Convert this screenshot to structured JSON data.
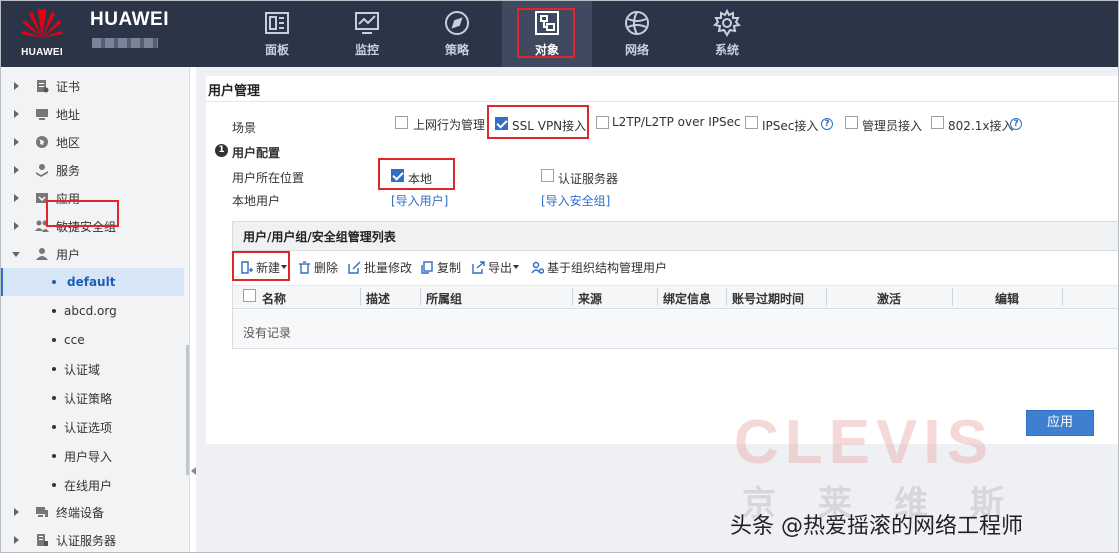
{
  "header": {
    "logo_text": "HUAWEI",
    "brand": "HUAWEI",
    "nav": [
      {
        "label": "面板",
        "icon": "dashboard-icon"
      },
      {
        "label": "监控",
        "icon": "monitor-icon"
      },
      {
        "label": "策略",
        "icon": "compass-icon"
      },
      {
        "label": "对象",
        "icon": "object-icon"
      },
      {
        "label": "网络",
        "icon": "globe-icon"
      },
      {
        "label": "系统",
        "icon": "gear-icon"
      }
    ],
    "active_nav": "对象"
  },
  "sidebar": {
    "items": [
      {
        "label": "证书",
        "icon": "certificate-icon"
      },
      {
        "label": "地址",
        "icon": "address-icon"
      },
      {
        "label": "地区",
        "icon": "region-globe-icon"
      },
      {
        "label": "服务",
        "icon": "service-icon"
      },
      {
        "label": "应用",
        "icon": "application-icon"
      },
      {
        "label": "敏捷安全组",
        "icon": "security-group-icon"
      },
      {
        "label": "用户",
        "icon": "user-icon"
      }
    ],
    "user_children": [
      "default",
      "abcd.org",
      "cce",
      "认证域",
      "认证策略",
      "认证选项",
      "用户导入",
      "在线用户"
    ],
    "bottom_items": [
      {
        "label": "终端设备",
        "icon": "terminal-device-icon"
      },
      {
        "label": "认证服务器",
        "icon": "auth-server-icon"
      }
    ],
    "selected": "default"
  },
  "main": {
    "title": "用户管理",
    "scene_label": "场景",
    "scenes": [
      {
        "label": "上网行为管理",
        "checked": false
      },
      {
        "label": "SSL VPN接入",
        "checked": true
      },
      {
        "label": "L2TP/L2TP over IPSec",
        "checked": false
      },
      {
        "label": "IPSec接入",
        "checked": false
      },
      {
        "label": "管理员接入",
        "checked": false
      },
      {
        "label": "802.1x接入",
        "checked": false
      }
    ],
    "section_number": "1",
    "section_title": "用户配置",
    "location_label": "用户所在位置",
    "location_local": "本地",
    "location_local_checked": true,
    "location_auth_server": "认证服务器",
    "location_auth_server_checked": false,
    "local_user_label": "本地用户",
    "import_users_link": "[导入用户]",
    "import_groups_link": "[导入安全组]",
    "list": {
      "title": "用户/用户组/安全组管理列表",
      "toolbar": {
        "new": "新建",
        "delete": "删除",
        "batch_edit": "批量修改",
        "copy": "复制",
        "export": "导出",
        "org_manage": "基于组织结构管理用户"
      },
      "columns": [
        "名称",
        "描述",
        "所属组",
        "来源",
        "绑定信息",
        "账号过期时间",
        "激活",
        "编辑"
      ],
      "empty_text": "没有记录"
    },
    "apply_button": "应用"
  },
  "watermark": {
    "brand": "CLEVIS",
    "chinese": "京莱维斯"
  },
  "credit": "头条 @热爱摇滚的网络工程师"
}
